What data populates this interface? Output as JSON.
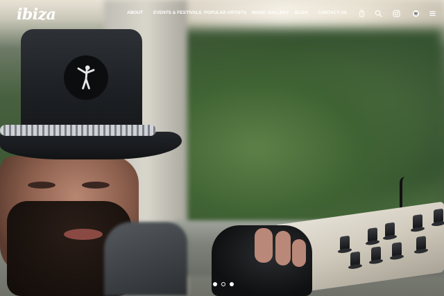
{
  "brand": {
    "logo_text": "ibiza"
  },
  "nav": {
    "items": [
      {
        "label": "ABOUT"
      },
      {
        "label": "EVENTS & FESTIVALS"
      },
      {
        "label": "POPULAR ARTISTS"
      },
      {
        "label": "MUSIC GALLERY"
      },
      {
        "label": "BLOG"
      },
      {
        "label": "CONTACT US"
      }
    ]
  },
  "header_icons": [
    {
      "name": "cart-icon",
      "badge": "0"
    },
    {
      "name": "search-icon"
    },
    {
      "name": "instagram-icon"
    },
    {
      "name": "spotify-icon"
    },
    {
      "name": "menu-icon"
    }
  ],
  "slider": {
    "slide_count": 3,
    "active_index": 1
  },
  "colors": {
    "nav_text": "#ffffff"
  }
}
